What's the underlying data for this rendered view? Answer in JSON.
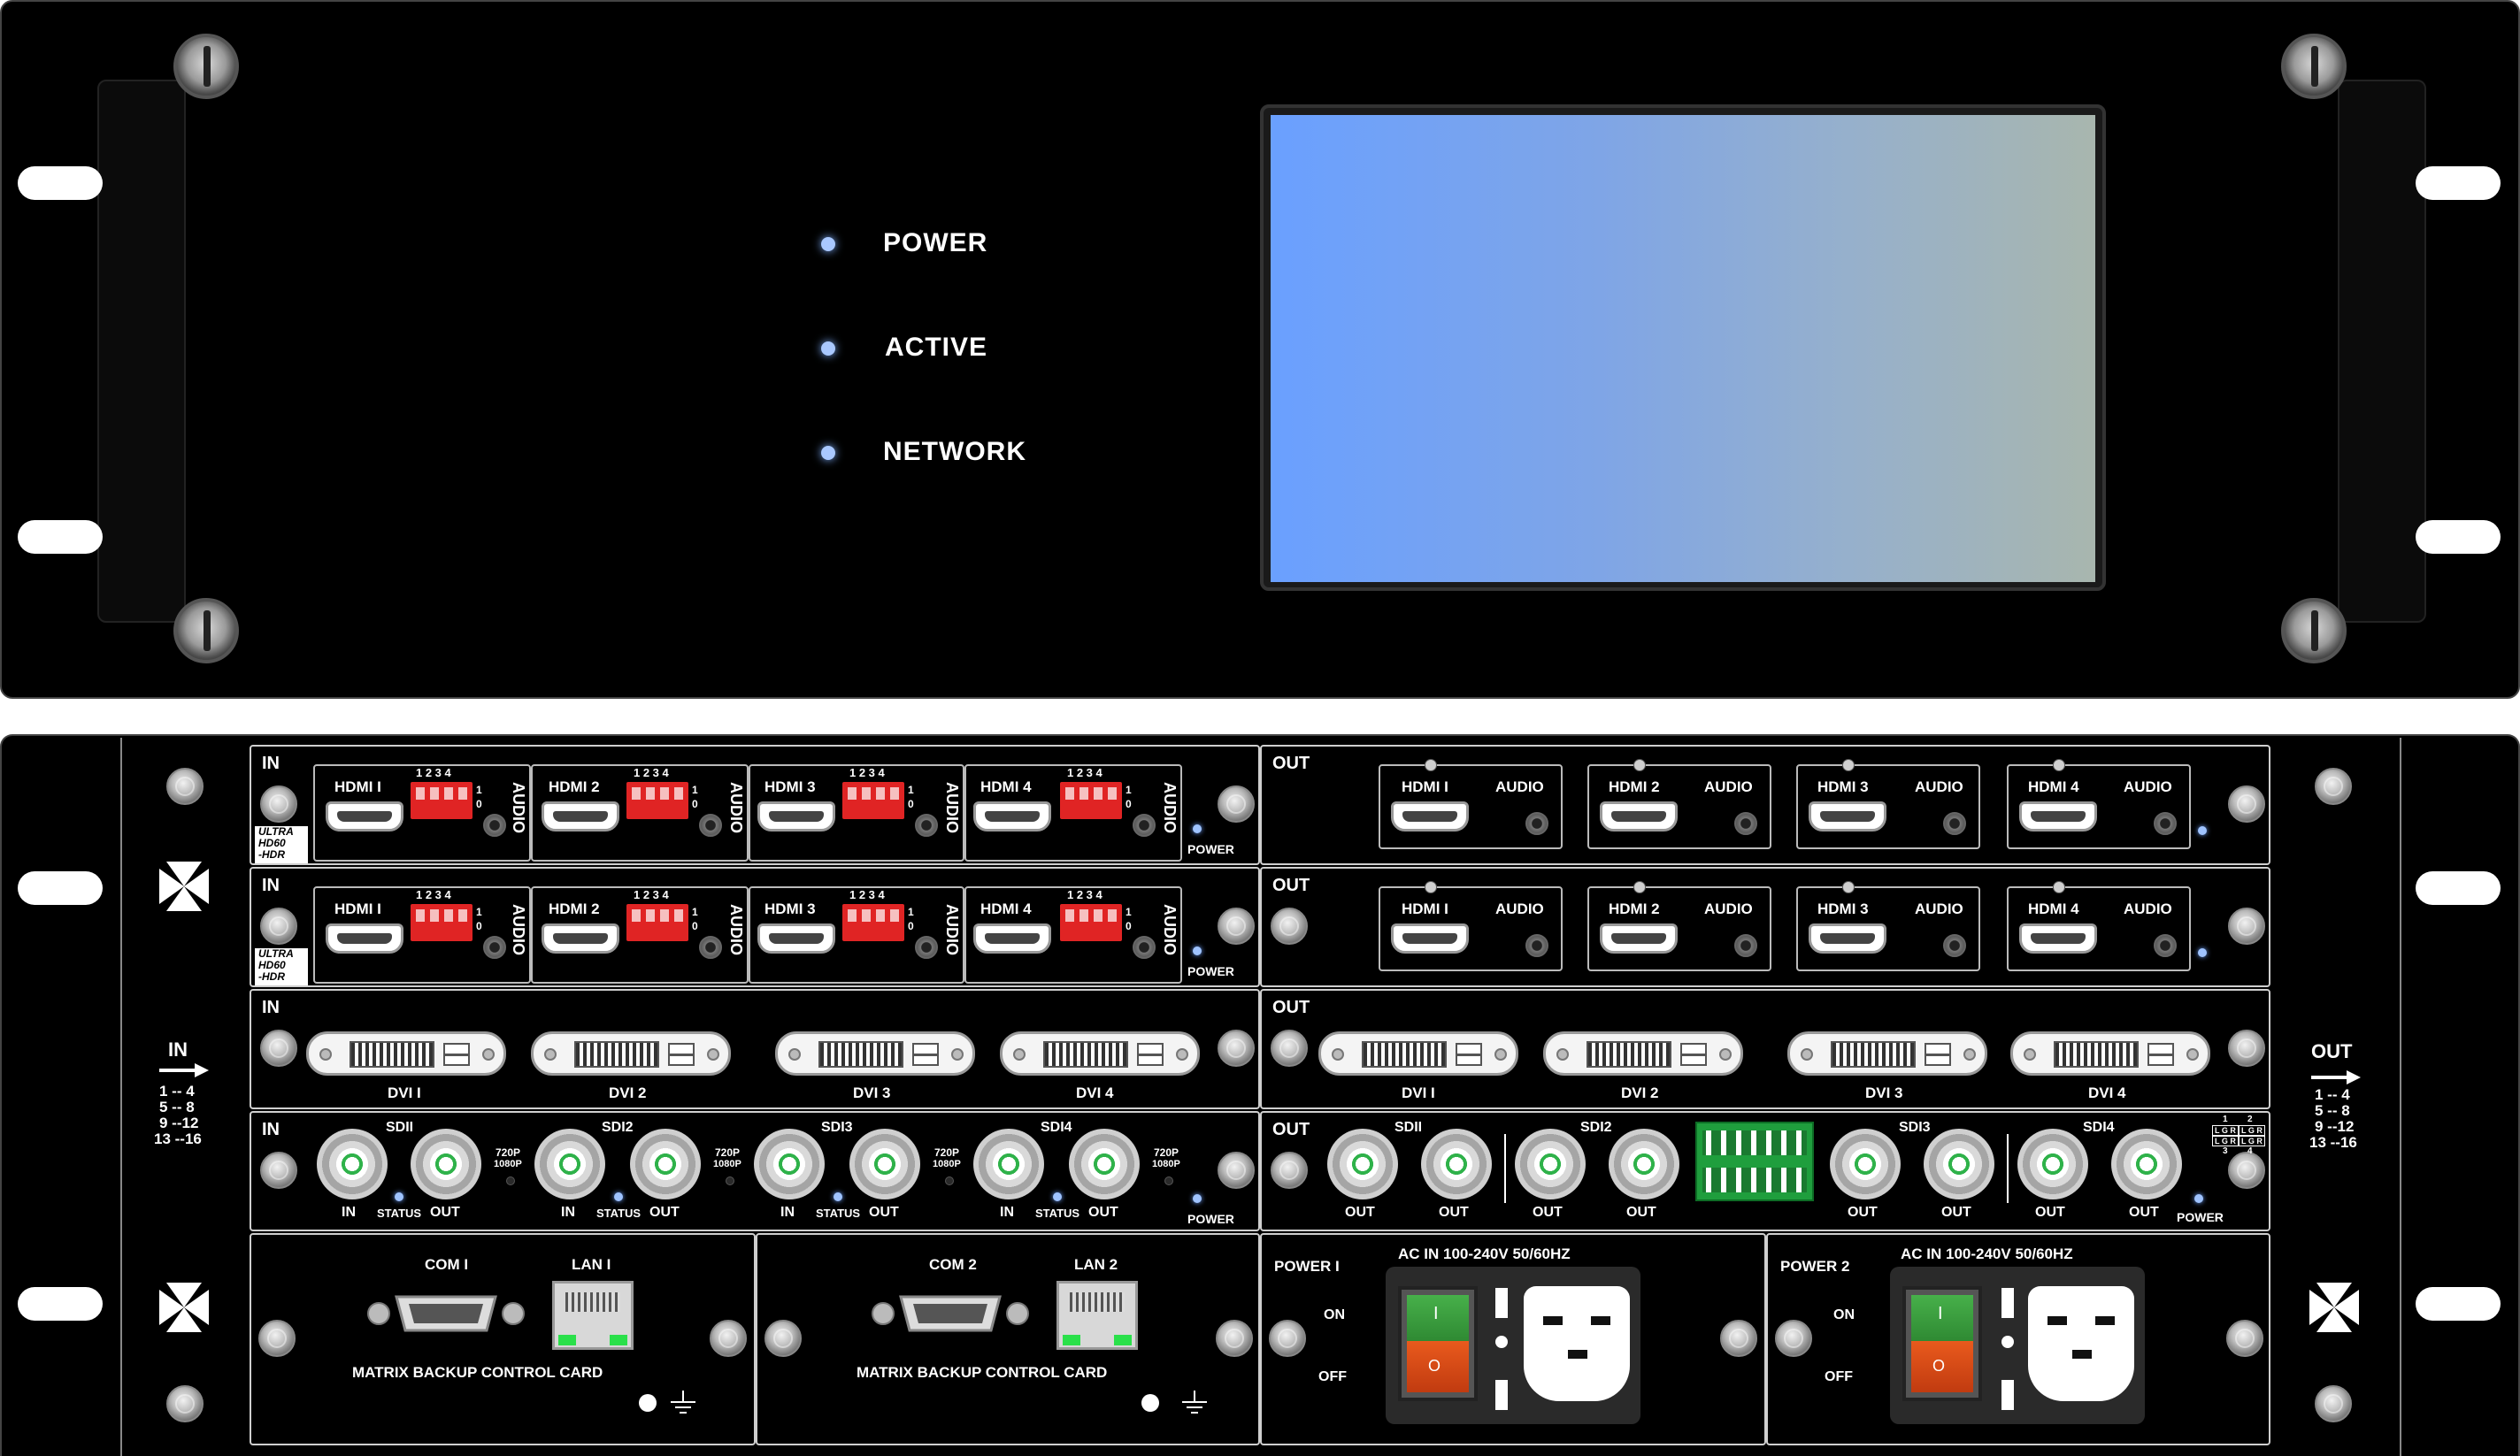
{
  "front_panel": {
    "indicators": [
      {
        "label": "POWER"
      },
      {
        "label": "ACTIVE"
      },
      {
        "label": "NETWORK"
      }
    ],
    "lcd_colors": [
      "#6aa0ff",
      "#a8b6ae"
    ]
  },
  "rear_panel": {
    "side_labels": {
      "left": {
        "title": "IN",
        "ranges": [
          "1 -- 4",
          "5 -- 8",
          "9 --12",
          "13 --16"
        ]
      },
      "right": {
        "title": "OUT",
        "ranges": [
          "1 -- 4",
          "5 -- 8",
          "9 --12",
          "13 --16"
        ]
      }
    },
    "hdmi_input_cards": [
      {
        "header": "IN",
        "badge": [
          "ULTRA",
          "HD60",
          "-HDR"
        ],
        "ports": [
          "HDMI I",
          "HDMI 2",
          "HDMI 3",
          "HDMI 4"
        ],
        "dip_numbers": "1 2 3 4",
        "dip_states": [
          "1",
          "0"
        ],
        "audio_label": "AUDIO",
        "power_label": "POWER"
      },
      {
        "header": "IN",
        "badge": [
          "ULTRA",
          "HD60",
          "-HDR"
        ],
        "ports": [
          "HDMI I",
          "HDMI 2",
          "HDMI 3",
          "HDMI 4"
        ],
        "dip_numbers": "1 2 3 4",
        "dip_states": [
          "1",
          "0"
        ],
        "audio_label": "AUDIO",
        "power_label": "POWER"
      }
    ],
    "hdmi_output_cards": [
      {
        "header": "OUT",
        "ports": [
          "HDMI I",
          "HDMI 2",
          "HDMI 3",
          "HDMI 4"
        ],
        "audio_label": "AUDIO"
      },
      {
        "header": "OUT",
        "ports": [
          "HDMI I",
          "HDMI 2",
          "HDMI 3",
          "HDMI 4"
        ],
        "audio_label": "AUDIO"
      }
    ],
    "dvi_input_card": {
      "header": "IN",
      "ports": [
        "DVI I",
        "DVI 2",
        "DVI 3",
        "DVI 4"
      ]
    },
    "dvi_output_card": {
      "header": "OUT",
      "ports": [
        "DVI I",
        "DVI 2",
        "DVI 3",
        "DVI 4"
      ]
    },
    "sdi_input_card": {
      "header": "IN",
      "ports": [
        "SDII",
        "SDI2",
        "SDI3",
        "SDI4"
      ],
      "in_label": "IN",
      "status_label": "STATUS",
      "out_label": "OUT",
      "res_labels": [
        "720P",
        "1080P"
      ],
      "power_label": "POWER"
    },
    "sdi_output_card": {
      "header": "OUT",
      "ports": [
        "SDII",
        "SDI2",
        "SDI3",
        "SDI4"
      ],
      "out_label": "OUT",
      "power_label": "POWER",
      "audio_numbers": [
        "1",
        "2",
        "3",
        "4"
      ],
      "audio_lr": "L G R"
    },
    "control_cards": [
      {
        "com": "COM I",
        "lan": "LAN I",
        "caption": "MATRIX BACKUP CONTROL CARD"
      },
      {
        "com": "COM 2",
        "lan": "LAN 2",
        "caption": "MATRIX BACKUP CONTROL CARD"
      }
    ],
    "power_modules": [
      {
        "title": "POWER I",
        "ac_label": "AC IN  100-240V 50/60HZ",
        "on_label": "ON",
        "off_label": "OFF",
        "rocker_on": "I",
        "rocker_off": "O"
      },
      {
        "title": "POWER 2",
        "ac_label": "AC IN  100-240V 50/60HZ",
        "on_label": "ON",
        "off_label": "OFF",
        "rocker_on": "I",
        "rocker_off": "O"
      }
    ]
  }
}
